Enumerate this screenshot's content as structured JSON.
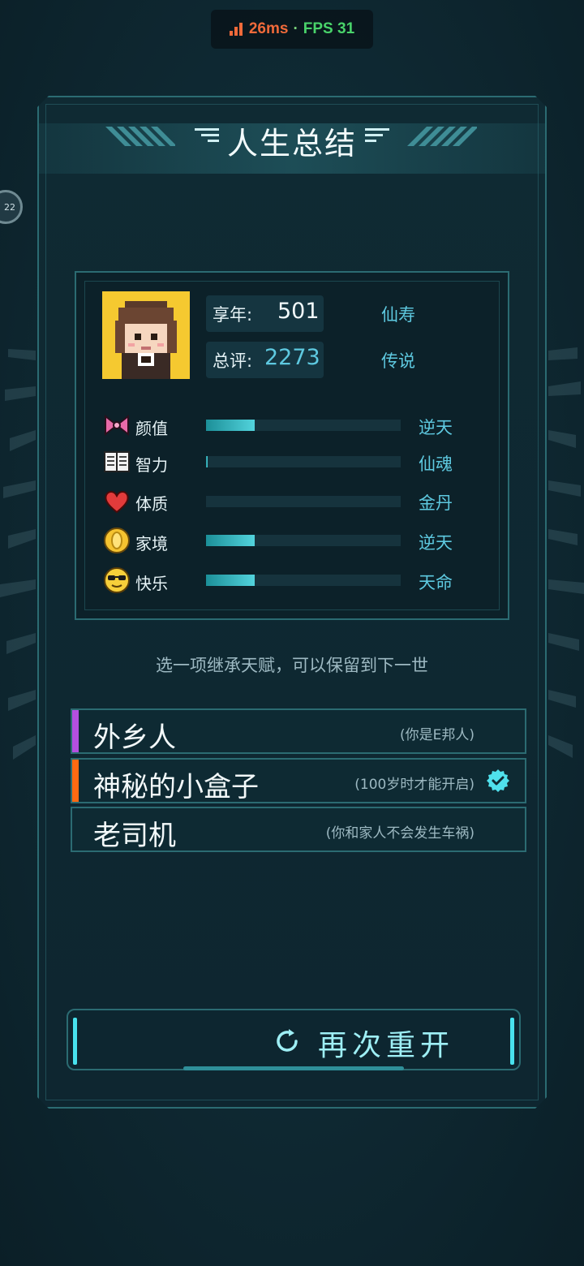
{
  "status_overlay": {
    "latency": "26ms",
    "separator": "·",
    "fps": "FPS 31"
  },
  "side_badge": {
    "text": "22"
  },
  "title": "人生总结",
  "summary": {
    "age_label": "享年:",
    "age_value": "501",
    "age_grade": "仙寿",
    "score_label": "总评:",
    "score_value": "2273",
    "score_grade": "传说"
  },
  "attributes": [
    {
      "icon": "bow-icon",
      "label": "颜值",
      "level": 0.25,
      "grade": "逆天"
    },
    {
      "icon": "book-icon",
      "label": "智力",
      "level": 0.01,
      "grade": "仙魂"
    },
    {
      "icon": "heart-icon",
      "label": "体质",
      "level": 0.0,
      "grade": "金丹"
    },
    {
      "icon": "coin-icon",
      "label": "家境",
      "level": 0.25,
      "grade": "逆天"
    },
    {
      "icon": "sunglasses-emoji-icon",
      "label": "快乐",
      "level": 0.25,
      "grade": "天命"
    }
  ],
  "hint": "选一项继承天赋，可以保留到下一世",
  "talents": [
    {
      "name": "外乡人",
      "desc": "(你是E邦人)",
      "accent": "#b44fe0",
      "selected": false
    },
    {
      "name": "神秘的小盒子",
      "desc": "(100岁时才能开启)",
      "accent": "#ff6a12",
      "selected": true
    },
    {
      "name": "老司机",
      "desc": "(你和家人不会发生车祸)",
      "accent": "",
      "selected": false
    }
  ],
  "restart_label": "再次重开",
  "colors": {
    "accent_cyan": "#5ec9e0",
    "bar_fill": "#52d3dc",
    "avatar_bg": "#f5c930"
  }
}
